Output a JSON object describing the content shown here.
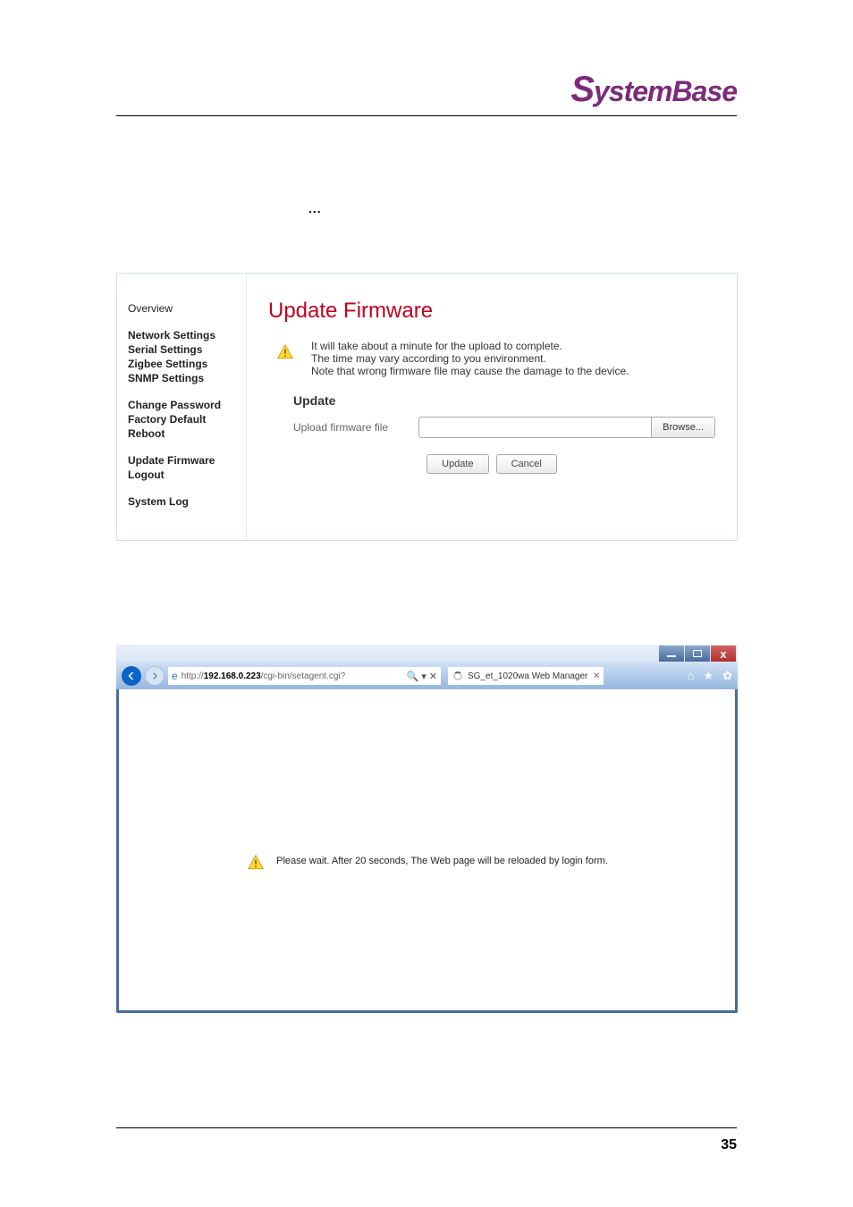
{
  "header": {
    "logo_text": "SystemBase"
  },
  "dots": "...",
  "fw": {
    "title": "Update Firmware",
    "nav": {
      "g1": [
        "Overview"
      ],
      "g2": [
        "Network Settings",
        "Serial Settings",
        "Zigbee Settings",
        "SNMP Settings"
      ],
      "g3": [
        "Change Password",
        "Factory Default",
        "Reboot"
      ],
      "g4": [
        "Update Firmware",
        "Logout"
      ],
      "g5": [
        "System Log"
      ]
    },
    "warn_lines": [
      "It will take about a minute for the upload to complete.",
      "The time may vary according to you environment.",
      "Note that wrong firmware file may cause the damage to the device."
    ],
    "update_label": "Update",
    "upload_label": "Upload firmware file",
    "browse_label": "Browse...",
    "btn_update": "Update",
    "btn_cancel": "Cancel"
  },
  "ie": {
    "url_prefix": "http://",
    "url_bold": "192.168.0.223",
    "url_suffix": "/cgi-bin/setagent.cgi?",
    "search_glyph": "🔍",
    "chevron": "▾",
    "stop_glyph": "✕",
    "tab_title": "SG_et_1020wa Web Manager",
    "wait_msg": "Please wait. After 20 seconds, The Web page will be reloaded by login form.",
    "close_glyph": "x"
  },
  "footer": {
    "page_no": "35"
  }
}
